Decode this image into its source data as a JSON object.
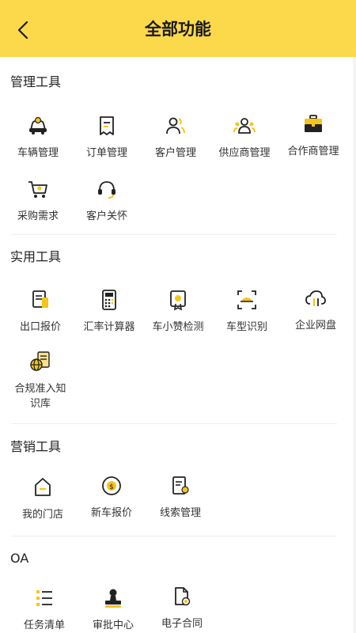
{
  "header": {
    "title": "全部功能"
  },
  "sections": [
    {
      "title": "管理工具",
      "items": [
        {
          "label": "车辆管理",
          "icon": "car-icon"
        },
        {
          "label": "订单管理",
          "icon": "order-icon"
        },
        {
          "label": "客户管理",
          "icon": "customers-icon"
        },
        {
          "label": "供应商管理",
          "icon": "supplier-icon"
        },
        {
          "label": "合作商管理",
          "icon": "toolbox-icon"
        },
        {
          "label": "采购需求",
          "icon": "cart-icon"
        },
        {
          "label": "客户关怀",
          "icon": "headset-icon"
        }
      ]
    },
    {
      "title": "实用工具",
      "items": [
        {
          "label": "出口报价",
          "icon": "document-icon"
        },
        {
          "label": "汇率计算器",
          "icon": "calculator-icon"
        },
        {
          "label": "车小赞检测",
          "icon": "certificate-icon"
        },
        {
          "label": "车型识别",
          "icon": "scan-car-icon"
        },
        {
          "label": "企业网盘",
          "icon": "cloud-icon"
        },
        {
          "label": "合规准入知识库",
          "icon": "globe-book-icon"
        }
      ]
    },
    {
      "title": "营销工具",
      "items": [
        {
          "label": "我的门店",
          "icon": "store-icon"
        },
        {
          "label": "新车报价",
          "icon": "price-icon"
        },
        {
          "label": "线索管理",
          "icon": "leads-icon"
        }
      ]
    },
    {
      "title": "OA",
      "items": [
        {
          "label": "任务清单",
          "icon": "checklist-icon"
        },
        {
          "label": "审批中心",
          "icon": "stamp-icon"
        },
        {
          "label": "电子合同",
          "icon": "contract-icon"
        }
      ]
    }
  ]
}
